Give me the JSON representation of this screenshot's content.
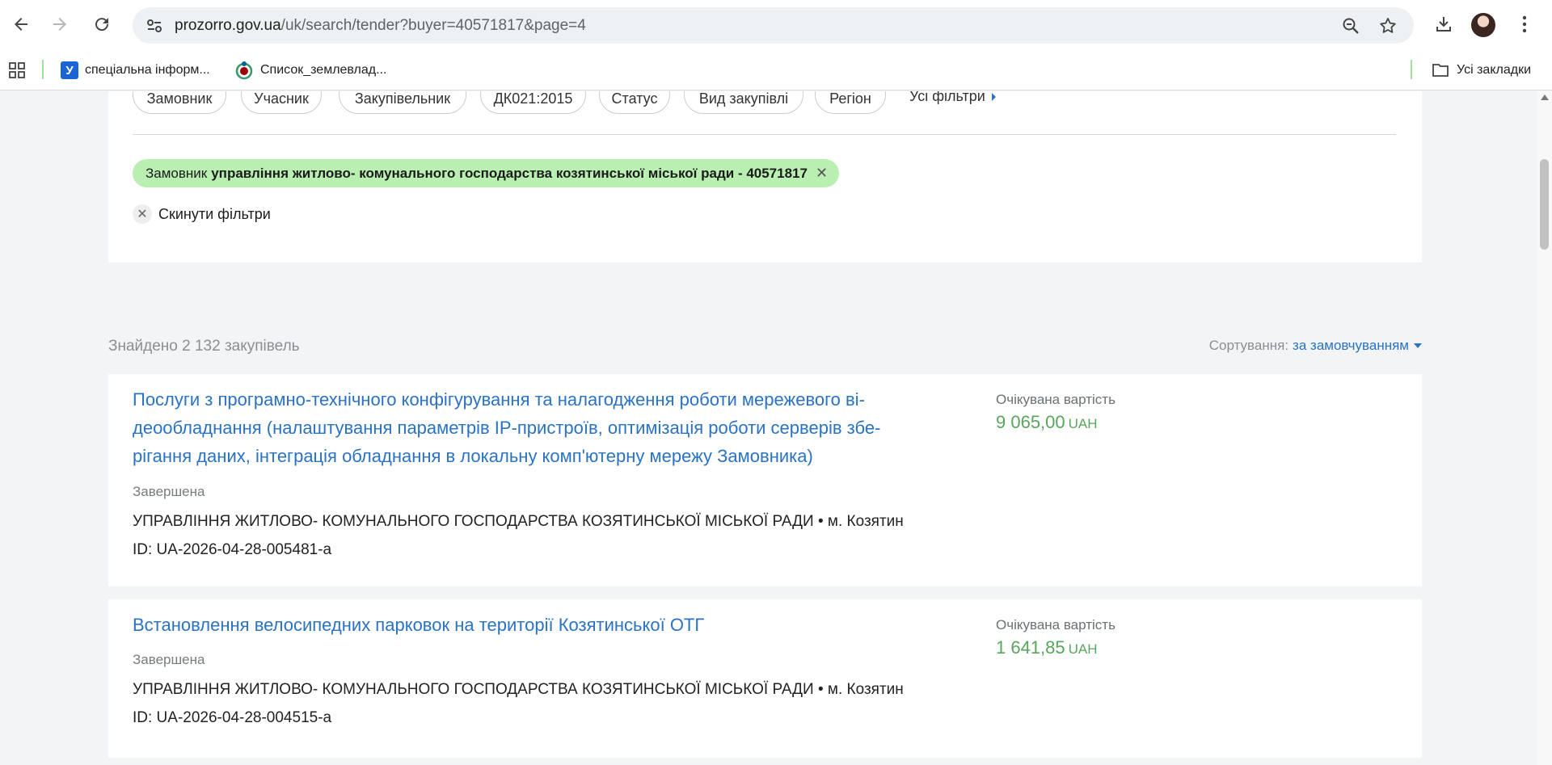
{
  "browser": {
    "url_host": "prozorro.gov.ua",
    "url_path": "/uk/search/tender?buyer=40571817&page=4",
    "icons": [
      "back-icon",
      "forward-icon",
      "reload-icon",
      "site-info-icon",
      "zoom-icon",
      "star-icon",
      "download-icon",
      "avatar",
      "menu-icon"
    ]
  },
  "bookmarks": {
    "items": [
      {
        "label": "спеціальна інформ..."
      },
      {
        "label": "Список_землевлад..."
      }
    ],
    "all_label": "Усі закладки"
  },
  "filters": {
    "chips": [
      "Замовник",
      "Учасник",
      "Закупівельник",
      "ДК021:2015",
      "Статус",
      "Вид закупівлі",
      "Регіон"
    ],
    "all_filters_label": "Усі фільтри",
    "active": {
      "prefix": "Замовник",
      "value": "управління житлово- комунального господарства козятинської міської ради - 40571817"
    },
    "reset_label": "Скинути фільтри"
  },
  "results": {
    "found_text": "Знайдено 2 132 закупівель",
    "sort_label": "Сортування:",
    "sort_value": "за замовчуванням"
  },
  "tenders": [
    {
      "title_lines": [
        "Послуги з програмно-технічного конфігурування та налагодження роботи мережевого ві-",
        "деообладнання (налаштування параметрів IP-пристроїв, оптимізація роботи серверів збе-",
        "рігання даних, інтеграція обладнання в локальну комп'ютерну мережу Замовника)"
      ],
      "status": "Завершена",
      "buyer": "УПРАВЛІННЯ ЖИТЛОВО- КОМУНАЛЬНОГО ГОСПОДАРСТВА КОЗЯТИНСЬКОЇ МІСЬКОЇ РАДИ • м. Козятин",
      "id": "ID: UA-2026-04-28-005481-a",
      "value_label": "Очікувана вартість",
      "value": "9 065,00",
      "currency": "UAH"
    },
    {
      "title_lines": [
        "Встановлення велосипедних парковок на території Козятинської ОТГ"
      ],
      "status": "Завершена",
      "buyer": "УПРАВЛІННЯ ЖИТЛОВО- КОМУНАЛЬНОГО ГОСПОДАРСТВА КОЗЯТИНСЬКОЇ МІСЬКОЇ РАДИ • м. Козятин",
      "id": "ID: UA-2026-04-28-004515-a",
      "value_label": "Очікувана вартість",
      "value": "1 641,85",
      "currency": "UAH"
    }
  ],
  "colors": {
    "link": "#2a73c4",
    "value_green": "#58a55c",
    "active_filter_bg": "#b9f0b2"
  }
}
